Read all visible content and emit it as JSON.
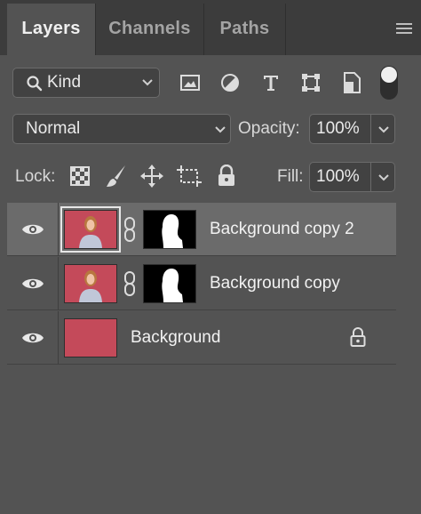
{
  "tabs": [
    {
      "label": "Layers",
      "active": true
    },
    {
      "label": "Channels",
      "active": false
    },
    {
      "label": "Paths",
      "active": false
    }
  ],
  "filter": {
    "label": "Kind"
  },
  "blend": {
    "mode": "Normal",
    "opacity_label": "Opacity:",
    "opacity": "100%"
  },
  "lock": {
    "label": "Lock:",
    "fill_label": "Fill:",
    "fill": "100%"
  },
  "layers": [
    {
      "name": "Background copy 2",
      "selected": true,
      "has_mask": true,
      "visible": true
    },
    {
      "name": "Background copy",
      "selected": false,
      "has_mask": true,
      "visible": true
    },
    {
      "name": "Background",
      "selected": false,
      "has_mask": false,
      "visible": true,
      "locked": true
    }
  ],
  "colors": {
    "panel": "#535353",
    "tabbar": "#3c3c3c",
    "selected_row": "#6b6b6b",
    "thumb": "#c44a5a"
  }
}
